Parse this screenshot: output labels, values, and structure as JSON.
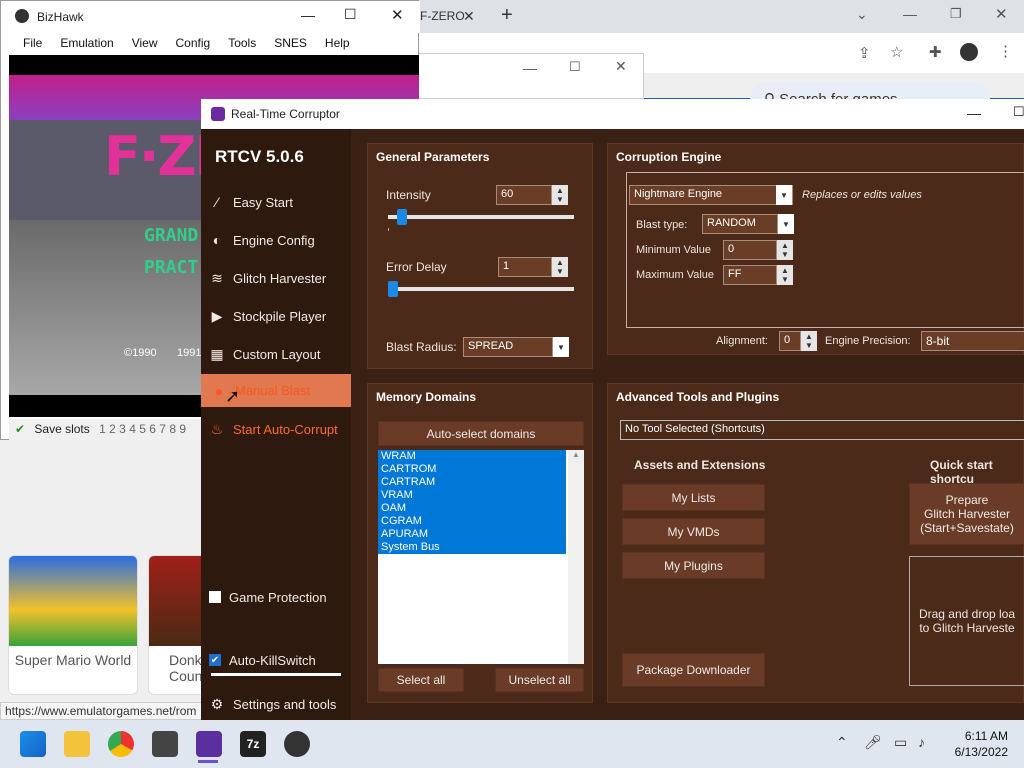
{
  "browser": {
    "tab_title": "F-ZERO",
    "search_placeholder": "Search for games",
    "status_url": "https://www.emulatorgames.net/rom",
    "cards": [
      {
        "caption": "Super Mario World"
      },
      {
        "caption": "Donk"
      },
      {
        "caption": "Coun"
      }
    ]
  },
  "bizhawk": {
    "title": "BizHawk",
    "menu": [
      "File",
      "Emulation",
      "View",
      "Config",
      "Tools",
      "SNES",
      "Help"
    ],
    "save_slots_label": "Save slots",
    "slots": [
      "1",
      "2",
      "3",
      "4",
      "5",
      "6",
      "7",
      "8",
      "9"
    ],
    "game_text": [
      "GRAND",
      "PRACT",
      "©1990",
      "1991"
    ]
  },
  "rtc": {
    "window_title": "Real-Time Corruptor",
    "version": "RTCV 5.0.6",
    "nav": {
      "easy_start": "Easy Start",
      "engine_config": "Engine Config",
      "glitch_harvester": "Glitch Harvester",
      "stockpile_player": "Stockpile Player",
      "custom_layout": "Custom Layout",
      "manual_blast": "Manual Blast",
      "start_auto_corrupt": "Start Auto-Corrupt",
      "game_protection": "Game Protection",
      "auto_killswitch": "Auto-KillSwitch",
      "settings_tools": "Settings and tools"
    },
    "general": {
      "header": "General Parameters",
      "intensity_label": "Intensity",
      "intensity_value": "60",
      "error_delay_label": "Error Delay",
      "error_delay_value": "1",
      "blast_radius_label": "Blast Radius:",
      "blast_radius_value": "SPREAD",
      "intensity_slider": 0.05,
      "error_delay_slider": 0.0
    },
    "engine": {
      "header": "Corruption Engine",
      "engine_value": "Nightmare Engine",
      "engine_desc": "Replaces or edits values",
      "blast_type_label": "Blast type:",
      "blast_type_value": "RANDOM",
      "min_label": "Minimum Value",
      "min_value": "0",
      "max_label": "Maximum Value",
      "max_value": "FF",
      "alignment_label": "Alignment:",
      "alignment_value": "0",
      "precision_label": "Engine Precision:",
      "precision_value": "8-bit"
    },
    "memory": {
      "header": "Memory Domains",
      "autoselect": "Auto-select domains",
      "domains": [
        "WRAM",
        "CARTROM",
        "CARTRAM",
        "VRAM",
        "OAM",
        "CGRAM",
        "APURAM",
        "System Bus"
      ],
      "select_all": "Select all",
      "unselect_all": "Unselect all"
    },
    "advanced": {
      "header": "Advanced Tools and Plugins",
      "tool_dropdown": "No Tool Selected (Shortcuts)",
      "assets_header": "Assets and Extensions",
      "my_lists": "My Lists",
      "my_vmds": "My VMDs",
      "my_plugins": "My Plugins",
      "package_downloader": "Package Downloader",
      "quick_header": "Quick start shortcu",
      "prepare_line1": "Prepare",
      "prepare_line2": "Glitch Harvester",
      "prepare_line3": "(Start+Savestate)",
      "drop_line1": "Drag and drop loa",
      "drop_line2": "to Glitch Harveste"
    }
  },
  "taskbar": {
    "time": "6:11 AM",
    "date": "6/13/2022"
  },
  "colors": {
    "accent_orange": "#ff6a2a",
    "rtc_bg": "#3a2114",
    "selection_blue": "#0078d7"
  }
}
